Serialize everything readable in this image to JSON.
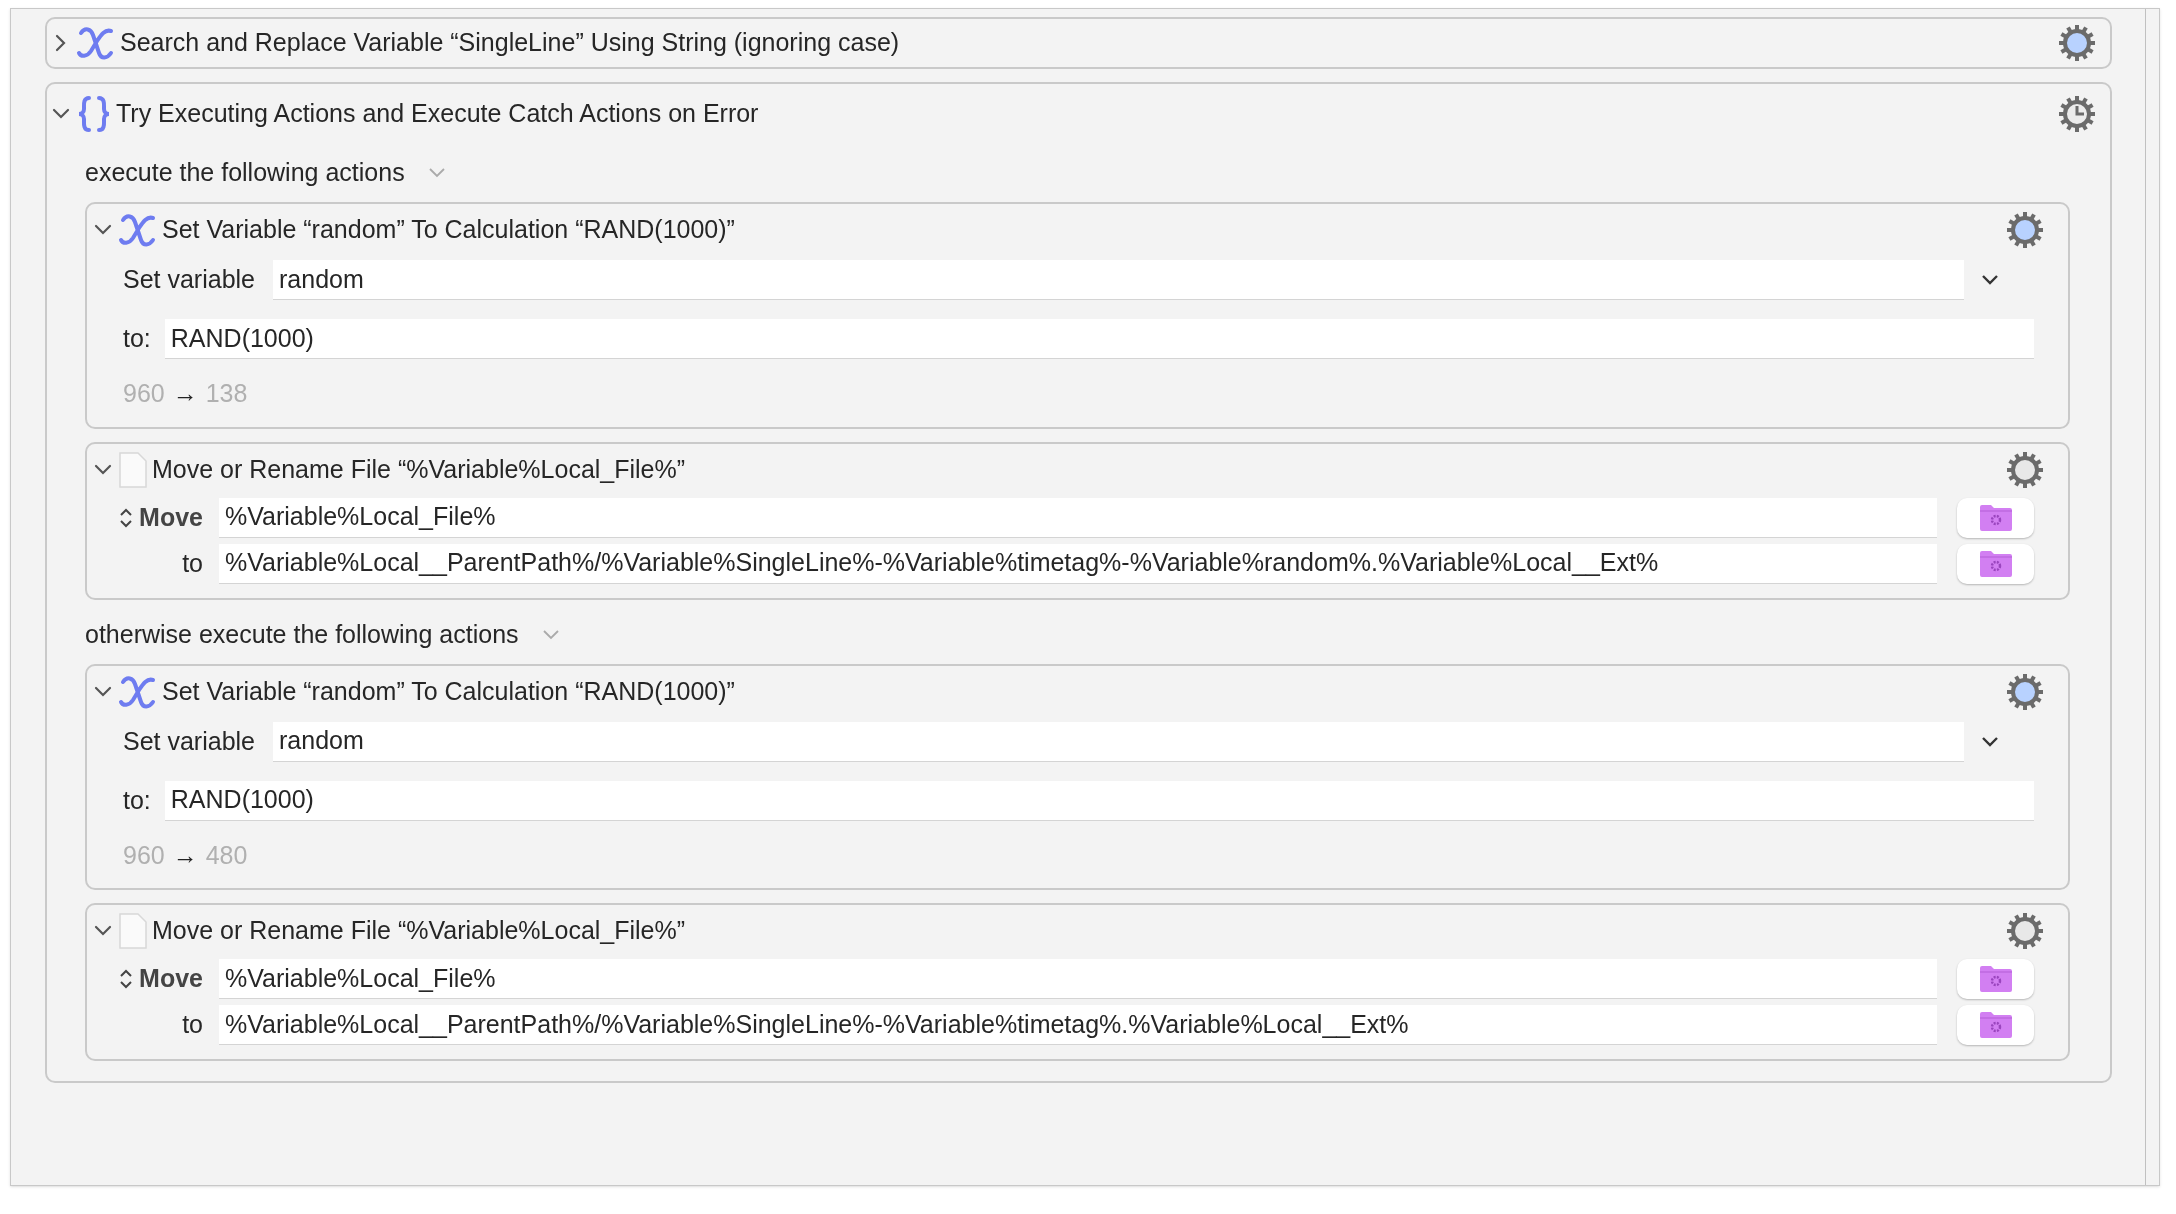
{
  "actions": [
    {
      "kind": "variable",
      "title": "Search and Replace Variable “SingleLine” Using String (ignoring case)",
      "expanded": false
    },
    {
      "kind": "try",
      "title": "Try Executing Actions and Execute Catch Actions on Error",
      "expanded": true,
      "sections": [
        {
          "label": "execute the following actions",
          "actions": [
            {
              "kind": "variable",
              "title": "Set Variable “random” To Calculation “RAND(1000)”",
              "expanded": true,
              "set_label": "Set variable",
              "variable": "random",
              "to_label": "to:",
              "value": "RAND(1000)",
              "result_from": "960",
              "arrow": "→",
              "result_to": "138"
            },
            {
              "kind": "file",
              "title": "Move or Rename File “%Variable%Local_File%”",
              "expanded": true,
              "mode_label": "Move",
              "source": "%Variable%Local_File%",
              "to_label": "to",
              "destination": "%Variable%Local__ParentPath%/%Variable%SingleLine%-%Variable%timetag%-%Variable%random%.%Variable%Local__Ext%"
            }
          ]
        },
        {
          "label": "otherwise execute the following actions",
          "actions": [
            {
              "kind": "variable",
              "title": "Set Variable “random” To Calculation “RAND(1000)”",
              "expanded": true,
              "set_label": "Set variable",
              "variable": "random",
              "to_label": "to:",
              "value": "RAND(1000)",
              "result_from": "960",
              "arrow": "→",
              "result_to": "480"
            },
            {
              "kind": "file",
              "title": "Move or Rename File “%Variable%Local_File%”",
              "expanded": true,
              "mode_label": "Move",
              "source": "%Variable%Local_File%",
              "to_label": "to",
              "destination": "%Variable%Local__ParentPath%/%Variable%SingleLine%-%Variable%timetag%.%Variable%Local__Ext%"
            }
          ]
        }
      ]
    }
  ]
}
